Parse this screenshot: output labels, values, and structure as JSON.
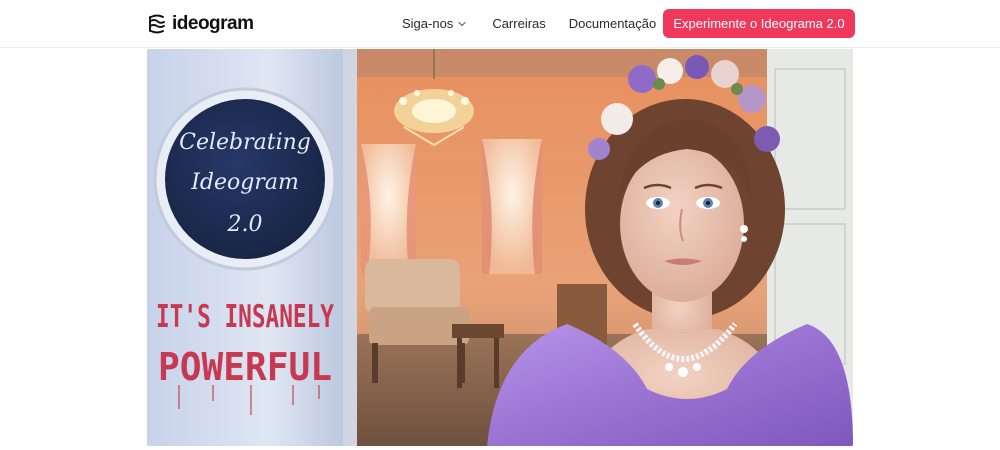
{
  "header": {
    "logo_text": "ideogram",
    "nav": {
      "follow_label": "Siga-nos",
      "careers_label": "Carreiras",
      "docs_label": "Documentação"
    },
    "cta_label": "Experimente o Ideograma 2.0"
  },
  "hero": {
    "sign_text": [
      "Celebrating",
      "Ideogram",
      "2.0"
    ],
    "graffiti_text": [
      "IT'S INSANELY",
      "POWERFUL"
    ]
  },
  "colors": {
    "accent": "#f0385b",
    "wall": "#d8e0ef",
    "room": "#e69a6c",
    "dress": "#a67fd9",
    "graffiti": "#c63950",
    "chalkboard": "#1e2f58"
  },
  "icons": {
    "logo": "ideogram-logo-icon",
    "dropdown": "chevron-down-icon"
  }
}
